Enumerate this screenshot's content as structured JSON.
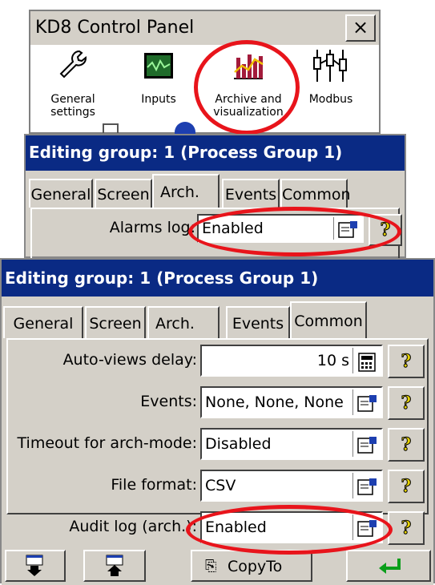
{
  "control_panel": {
    "title": "KD8 Control Panel",
    "close_label": "×",
    "icons": [
      {
        "name": "general-settings",
        "icon": "wrench-icon",
        "label_line1": "General",
        "label_line2": "settings"
      },
      {
        "name": "inputs",
        "icon": "waveform-icon",
        "label_line1": "Inputs",
        "label_line2": ""
      },
      {
        "name": "archive",
        "icon": "bar-chart-icon",
        "label_line1": "Archive and",
        "label_line2": "visualization"
      },
      {
        "name": "modbus",
        "icon": "modbus-icon",
        "label_line1": "Modbus",
        "label_line2": ""
      }
    ]
  },
  "dialog_arch": {
    "title": "Editing group: 1 (Process Group 1)",
    "tabs": [
      "General",
      "Screen",
      "Arch.",
      "Events",
      "Common"
    ],
    "active_tab": "Arch.",
    "alarms_log_label": "Alarms log:",
    "alarms_log_value": "Enabled"
  },
  "dialog_common": {
    "title": "Editing group: 1 (Process Group 1)",
    "tabs": [
      "General",
      "Screen",
      "Arch.",
      "Events",
      "Common"
    ],
    "active_tab": "Common",
    "rows": [
      {
        "label": "Auto-views delay:",
        "value": "10 s",
        "button": "calculator-icon"
      },
      {
        "label": "Events:",
        "value": "None, None, None",
        "button": "properties-icon"
      },
      {
        "label": "Timeout for arch-mode:",
        "value": "Disabled",
        "button": "properties-icon"
      },
      {
        "label": "File format:",
        "value": "CSV",
        "button": "properties-icon"
      },
      {
        "label": "Audit log (arch.):",
        "value": "Enabled",
        "button": "properties-icon"
      }
    ],
    "copyto_label": "CopyTo"
  },
  "colors": {
    "titlebar": "#0a2a84",
    "highlight_ring": "#e8141b",
    "face": "#d4d0c8"
  }
}
